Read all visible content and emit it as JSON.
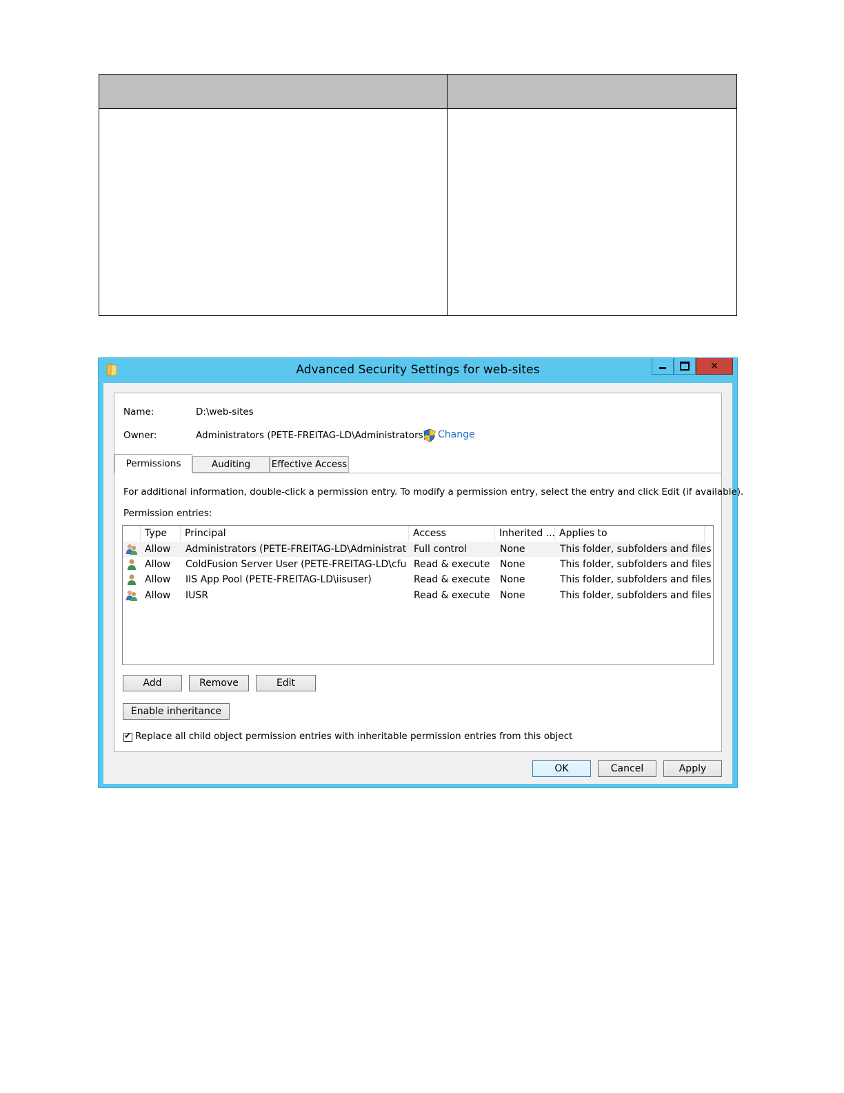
{
  "window": {
    "title": "Advanced Security Settings for web-sites"
  },
  "info": {
    "name_label": "Name:",
    "name_value": "D:\\web-sites",
    "owner_label": "Owner:",
    "owner_value": "Administrators (PETE-FREITAG-LD\\Administrators)",
    "change_link": "Change"
  },
  "tabs": [
    {
      "label": "Permissions",
      "active": true
    },
    {
      "label": "Auditing",
      "active": false
    },
    {
      "label": "Effective Access",
      "active": false
    }
  ],
  "permissions": {
    "instructions": "For additional information, double-click a permission entry. To modify a permission entry, select the entry and click Edit (if available).",
    "entries_label": "Permission entries:",
    "columns": [
      "Type",
      "Principal",
      "Access",
      "Inherited ...",
      "Applies to"
    ],
    "rows": [
      {
        "icon": "group-users-icon",
        "type": "Allow",
        "principal": "Administrators (PETE-FREITAG-LD\\Administrato...",
        "access": "Full control",
        "inherited": "None",
        "applies_to": "This folder, subfolders and files"
      },
      {
        "icon": "single-user-icon",
        "type": "Allow",
        "principal": "ColdFusion Server User (PETE-FREITAG-LD\\cfuser)",
        "access": "Read & execute",
        "inherited": "None",
        "applies_to": "This folder, subfolders and files"
      },
      {
        "icon": "single-user-icon",
        "type": "Allow",
        "principal": "IIS App Pool (PETE-FREITAG-LD\\iisuser)",
        "access": "Read & execute",
        "inherited": "None",
        "applies_to": "This folder, subfolders and files"
      },
      {
        "icon": "group-users-icon",
        "type": "Allow",
        "principal": "IUSR",
        "access": "Read & execute",
        "inherited": "None",
        "applies_to": "This folder, subfolders and files"
      }
    ]
  },
  "buttons": {
    "add": "Add",
    "remove": "Remove",
    "edit": "Edit",
    "enable_inheritance": "Enable inheritance",
    "ok": "OK",
    "cancel": "Cancel",
    "apply": "Apply"
  },
  "replace_checkbox": {
    "label": "Replace all child object permission entries with inheritable permission entries from this object",
    "checked": true
  }
}
